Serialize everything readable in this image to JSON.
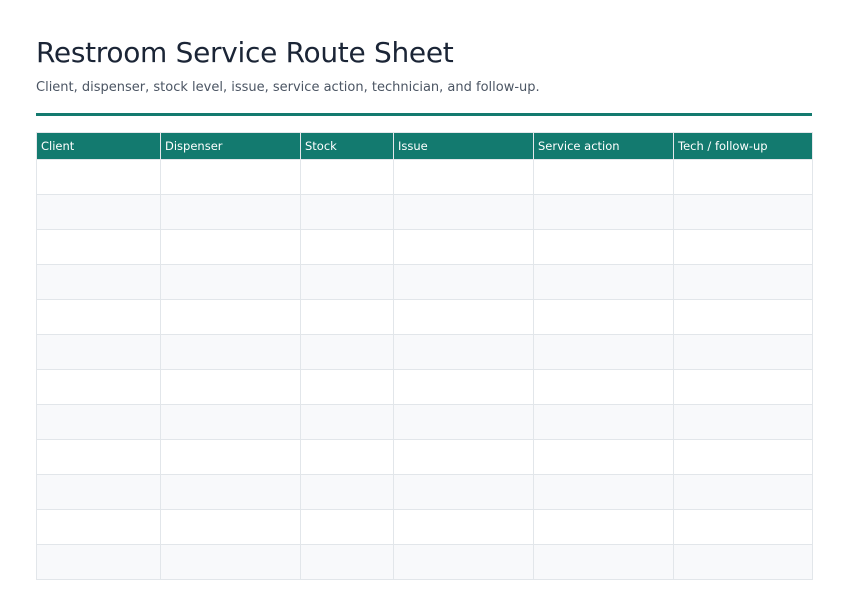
{
  "header": {
    "title": "Restroom Service Route Sheet",
    "subtitle": "Client, dispenser, stock level, issue, service action, technician, and follow-up."
  },
  "table": {
    "columns": [
      "Client",
      "Dispenser",
      "Stock",
      "Issue",
      "Service action",
      "Tech / follow-up"
    ],
    "row_count": 12,
    "rows": [
      [
        "",
        "",
        "",
        "",
        "",
        ""
      ],
      [
        "",
        "",
        "",
        "",
        "",
        ""
      ],
      [
        "",
        "",
        "",
        "",
        "",
        ""
      ],
      [
        "",
        "",
        "",
        "",
        "",
        ""
      ],
      [
        "",
        "",
        "",
        "",
        "",
        ""
      ],
      [
        "",
        "",
        "",
        "",
        "",
        ""
      ],
      [
        "",
        "",
        "",
        "",
        "",
        ""
      ],
      [
        "",
        "",
        "",
        "",
        "",
        ""
      ],
      [
        "",
        "",
        "",
        "",
        "",
        ""
      ],
      [
        "",
        "",
        "",
        "",
        "",
        ""
      ],
      [
        "",
        "",
        "",
        "",
        "",
        ""
      ],
      [
        "",
        "",
        "",
        "",
        "",
        ""
      ]
    ]
  },
  "colors": {
    "accent": "#137a6f",
    "stripe": "#f8f9fb",
    "grid": "#e2e6ea"
  }
}
